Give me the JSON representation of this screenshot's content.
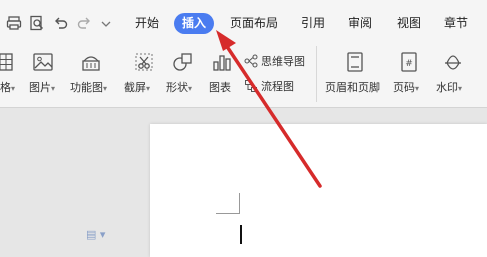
{
  "menu": {
    "tabs": [
      {
        "label": "开始"
      },
      {
        "label": "插入",
        "active": true
      },
      {
        "label": "页面布局"
      },
      {
        "label": "引用"
      },
      {
        "label": "审阅"
      },
      {
        "label": "视图"
      },
      {
        "label": "章节"
      }
    ],
    "active_color": "#4a7cf0"
  },
  "quick_access": [
    "print-icon",
    "print-preview-icon",
    "undo-icon",
    "redo-icon",
    "customize-dropdown-icon"
  ],
  "ribbon": {
    "table_label": "格",
    "picture_label": "图片",
    "function_chart_label": "功能图",
    "screenshot_label": "截屏",
    "shape_label": "形状",
    "chart_label": "图表",
    "mindmap_label": "思维导图",
    "flowchart_label": "流程图",
    "header_footer_label": "页眉和页脚",
    "page_number_label": "页码",
    "watermark_label": "水印",
    "caret": "▾"
  },
  "document": {
    "side_icon": "▤ ▾"
  },
  "annotation": {
    "arrow_color": "#d62b2b"
  }
}
